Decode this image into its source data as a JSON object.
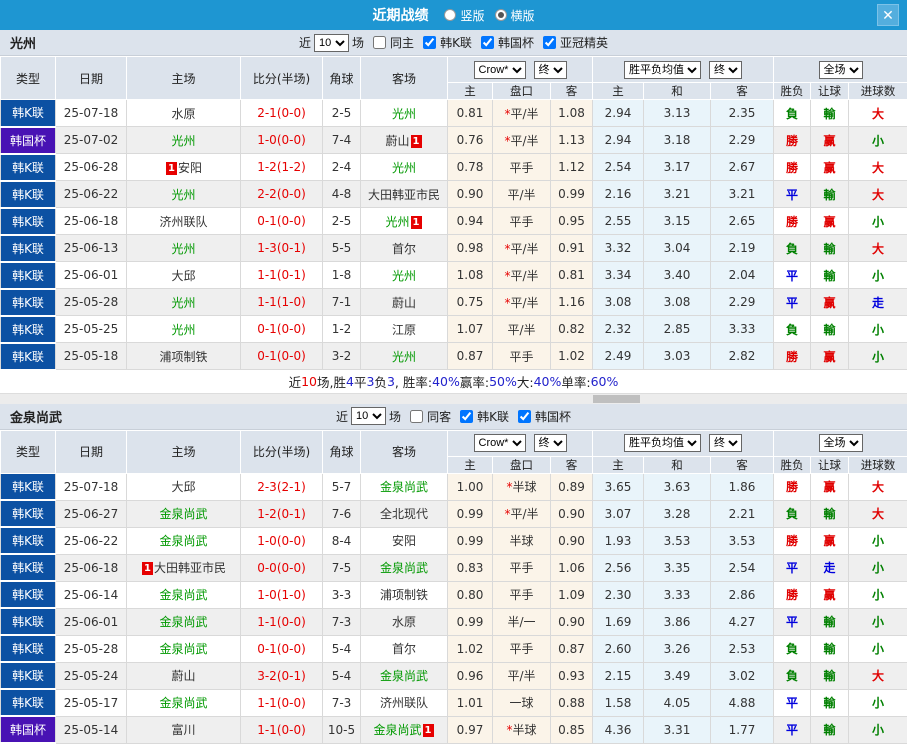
{
  "titlebar": {
    "title": "近期战绩",
    "radio_vertical": {
      "label": "竖版",
      "checked": false
    },
    "radio_horizontal": {
      "label": "横版",
      "checked": true
    },
    "close_label": "✕"
  },
  "colors": {
    "titlebar_blue": "#1e96d2",
    "league_badge_blue": "#0c51a3",
    "cup_badge_purple": "#4812b4",
    "team_green": "#009900",
    "score_red": "#e60000",
    "win_red": "#e00000",
    "loss_green": "#008000",
    "draw_blue": "#0000dd",
    "asia_odds_bg": "#fbf4e9",
    "euro_odds_bg": "#e9f4fa",
    "header_bg": "#dce3ec"
  },
  "table_header": {
    "type": "类型",
    "date": "日期",
    "home": "主场",
    "score": "比分(半场)",
    "corner": "角球",
    "away": "客场",
    "asia_home": "主",
    "handicap": "盘口",
    "asia_away": "客",
    "euro_home": "主",
    "euro_draw": "和",
    "euro_away": "客",
    "result": "胜负",
    "handicap_result": "让球",
    "goals": "进球数",
    "bookmaker_select": "Crow*",
    "final_select": "终",
    "odds_mean_select": "胜平负均值",
    "final_select2": "终",
    "scope_select": "全场"
  },
  "sections": [
    {
      "team": "光州",
      "filter": {
        "recent_label": "近",
        "count": "10",
        "matches_label": "场",
        "same": {
          "label": "同主",
          "checked": false
        },
        "leagues": [
          {
            "label": "韩K联",
            "checked": true
          },
          {
            "label": "韩国杯",
            "checked": true
          },
          {
            "label": "亚冠精英",
            "checked": true
          }
        ]
      },
      "rows": [
        {
          "type": "韩K联",
          "date": "25-07-18",
          "home": {
            "name": "水原",
            "green": false
          },
          "score": "2-1(0-0)",
          "corner": "2-5",
          "away": {
            "name": "光州",
            "green": true
          },
          "asia": [
            "0.81",
            "*平/半",
            "1.08"
          ],
          "euro": [
            "2.94",
            "3.13",
            "2.35"
          ],
          "results": [
            "負",
            "輸",
            "大"
          ]
        },
        {
          "type": "韩国杯",
          "date": "25-07-02",
          "home": {
            "name": "光州",
            "green": true
          },
          "score": "1-0(0-0)",
          "corner": "7-4",
          "away": {
            "name": "蔚山",
            "green": false,
            "badge": "1",
            "badge_pos": "after"
          },
          "asia": [
            "0.76",
            "*平/半",
            "1.13"
          ],
          "euro": [
            "2.94",
            "3.18",
            "2.29"
          ],
          "results": [
            "勝",
            "赢",
            "小"
          ]
        },
        {
          "type": "韩K联",
          "date": "25-06-28",
          "home": {
            "name": "安阳",
            "green": false,
            "badge": "1",
            "badge_pos": "before"
          },
          "score": "1-2(1-2)",
          "corner": "2-4",
          "away": {
            "name": "光州",
            "green": true
          },
          "asia": [
            "0.78",
            "平手",
            "1.12"
          ],
          "euro": [
            "2.54",
            "3.17",
            "2.67"
          ],
          "results": [
            "勝",
            "赢",
            "大"
          ]
        },
        {
          "type": "韩K联",
          "date": "25-06-22",
          "home": {
            "name": "光州",
            "green": true
          },
          "score": "2-2(0-0)",
          "corner": "4-8",
          "away": {
            "name": "大田韩亚市民",
            "green": false
          },
          "asia": [
            "0.90",
            "平/半",
            "0.99"
          ],
          "euro": [
            "2.16",
            "3.21",
            "3.21"
          ],
          "results": [
            "平",
            "輸",
            "大"
          ]
        },
        {
          "type": "韩K联",
          "date": "25-06-18",
          "home": {
            "name": "济州联队",
            "green": false
          },
          "score": "0-1(0-0)",
          "corner": "2-5",
          "away": {
            "name": "光州",
            "green": true,
            "badge": "1",
            "badge_pos": "after"
          },
          "asia": [
            "0.94",
            "平手",
            "0.95"
          ],
          "euro": [
            "2.55",
            "3.15",
            "2.65"
          ],
          "results": [
            "勝",
            "赢",
            "小"
          ]
        },
        {
          "type": "韩K联",
          "date": "25-06-13",
          "home": {
            "name": "光州",
            "green": true
          },
          "score": "1-3(0-1)",
          "corner": "5-5",
          "away": {
            "name": "首尔",
            "green": false
          },
          "asia": [
            "0.98",
            "*平/半",
            "0.91"
          ],
          "euro": [
            "3.32",
            "3.04",
            "2.19"
          ],
          "results": [
            "負",
            "輸",
            "大"
          ]
        },
        {
          "type": "韩K联",
          "date": "25-06-01",
          "home": {
            "name": "大邱",
            "green": false
          },
          "score": "1-1(0-1)",
          "corner": "1-8",
          "away": {
            "name": "光州",
            "green": true
          },
          "asia": [
            "1.08",
            "*平/半",
            "0.81"
          ],
          "euro": [
            "3.34",
            "3.40",
            "2.04"
          ],
          "results": [
            "平",
            "輸",
            "小"
          ]
        },
        {
          "type": "韩K联",
          "date": "25-05-28",
          "home": {
            "name": "光州",
            "green": true
          },
          "score": "1-1(1-0)",
          "corner": "7-1",
          "away": {
            "name": "蔚山",
            "green": false
          },
          "asia": [
            "0.75",
            "*平/半",
            "1.16"
          ],
          "euro": [
            "3.08",
            "3.08",
            "2.29"
          ],
          "results": [
            "平",
            "赢",
            "走"
          ]
        },
        {
          "type": "韩K联",
          "date": "25-05-25",
          "home": {
            "name": "光州",
            "green": true
          },
          "score": "0-1(0-0)",
          "corner": "1-2",
          "away": {
            "name": "江原",
            "green": false
          },
          "asia": [
            "1.07",
            "平/半",
            "0.82"
          ],
          "euro": [
            "2.32",
            "2.85",
            "3.33"
          ],
          "results": [
            "負",
            "輸",
            "小"
          ]
        },
        {
          "type": "韩K联",
          "date": "25-05-18",
          "home": {
            "name": "浦项制铁",
            "green": false
          },
          "score": "0-1(0-0)",
          "corner": "3-2",
          "away": {
            "name": "光州",
            "green": true
          },
          "asia": [
            "0.87",
            "平手",
            "1.02"
          ],
          "euro": [
            "2.49",
            "3.03",
            "2.82"
          ],
          "results": [
            "勝",
            "赢",
            "小"
          ]
        }
      ],
      "summary_parts": [
        {
          "t": "近",
          "c": "k"
        },
        {
          "t": "10",
          "c": "r"
        },
        {
          "t": "场,胜",
          "c": "k"
        },
        {
          "t": "4",
          "c": "b"
        },
        {
          "t": "平",
          "c": "k"
        },
        {
          "t": "3",
          "c": "b"
        },
        {
          "t": "负",
          "c": "k"
        },
        {
          "t": "3",
          "c": "b"
        },
        {
          "t": ", 胜率:",
          "c": "k"
        },
        {
          "t": "40%",
          "c": "b"
        },
        {
          "t": " 赢率:",
          "c": "k"
        },
        {
          "t": "50%",
          "c": "b"
        },
        {
          "t": " 大:",
          "c": "k"
        },
        {
          "t": "40%",
          "c": "b"
        },
        {
          "t": " 单率:",
          "c": "k"
        },
        {
          "t": "60%",
          "c": "b"
        }
      ]
    },
    {
      "team": "金泉尚武",
      "filter": {
        "recent_label": "近",
        "count": "10",
        "matches_label": "场",
        "same": {
          "label": "同客",
          "checked": false
        },
        "leagues": [
          {
            "label": "韩K联",
            "checked": true
          },
          {
            "label": "韩国杯",
            "checked": true
          }
        ]
      },
      "rows": [
        {
          "type": "韩K联",
          "date": "25-07-18",
          "home": {
            "name": "大邱",
            "green": false
          },
          "score": "2-3(2-1)",
          "corner": "5-7",
          "away": {
            "name": "金泉尚武",
            "green": true
          },
          "asia": [
            "1.00",
            "*半球",
            "0.89"
          ],
          "euro": [
            "3.65",
            "3.63",
            "1.86"
          ],
          "results": [
            "勝",
            "赢",
            "大"
          ]
        },
        {
          "type": "韩K联",
          "date": "25-06-27",
          "home": {
            "name": "金泉尚武",
            "green": true
          },
          "score": "1-2(0-1)",
          "corner": "7-6",
          "away": {
            "name": "全北现代",
            "green": false
          },
          "asia": [
            "0.99",
            "*平/半",
            "0.90"
          ],
          "euro": [
            "3.07",
            "3.28",
            "2.21"
          ],
          "results": [
            "負",
            "輸",
            "大"
          ]
        },
        {
          "type": "韩K联",
          "date": "25-06-22",
          "home": {
            "name": "金泉尚武",
            "green": true
          },
          "score": "1-0(0-0)",
          "corner": "8-4",
          "away": {
            "name": "安阳",
            "green": false
          },
          "asia": [
            "0.99",
            "半球",
            "0.90"
          ],
          "euro": [
            "1.93",
            "3.53",
            "3.53"
          ],
          "results": [
            "勝",
            "赢",
            "小"
          ]
        },
        {
          "type": "韩K联",
          "date": "25-06-18",
          "home": {
            "name": "大田韩亚市民",
            "green": false,
            "badge": "1",
            "badge_pos": "before"
          },
          "score": "0-0(0-0)",
          "corner": "7-5",
          "away": {
            "name": "金泉尚武",
            "green": true
          },
          "asia": [
            "0.83",
            "平手",
            "1.06"
          ],
          "euro": [
            "2.56",
            "3.35",
            "2.54"
          ],
          "results": [
            "平",
            "走",
            "小"
          ]
        },
        {
          "type": "韩K联",
          "date": "25-06-14",
          "home": {
            "name": "金泉尚武",
            "green": true
          },
          "score": "1-0(1-0)",
          "corner": "3-3",
          "away": {
            "name": "浦项制铁",
            "green": false
          },
          "asia": [
            "0.80",
            "平手",
            "1.09"
          ],
          "euro": [
            "2.30",
            "3.33",
            "2.86"
          ],
          "results": [
            "勝",
            "赢",
            "小"
          ]
        },
        {
          "type": "韩K联",
          "date": "25-06-01",
          "home": {
            "name": "金泉尚武",
            "green": true
          },
          "score": "1-1(0-0)",
          "corner": "7-3",
          "away": {
            "name": "水原",
            "green": false
          },
          "asia": [
            "0.99",
            "半/一",
            "0.90"
          ],
          "euro": [
            "1.69",
            "3.86",
            "4.27"
          ],
          "results": [
            "平",
            "輸",
            "小"
          ]
        },
        {
          "type": "韩K联",
          "date": "25-05-28",
          "home": {
            "name": "金泉尚武",
            "green": true
          },
          "score": "0-1(0-0)",
          "corner": "5-4",
          "away": {
            "name": "首尔",
            "green": false
          },
          "asia": [
            "1.02",
            "平手",
            "0.87"
          ],
          "euro": [
            "2.60",
            "3.26",
            "2.53"
          ],
          "results": [
            "負",
            "輸",
            "小"
          ]
        },
        {
          "type": "韩K联",
          "date": "25-05-24",
          "home": {
            "name": "蔚山",
            "green": false
          },
          "score": "3-2(0-1)",
          "corner": "5-4",
          "away": {
            "name": "金泉尚武",
            "green": true
          },
          "asia": [
            "0.96",
            "平/半",
            "0.93"
          ],
          "euro": [
            "2.15",
            "3.49",
            "3.02"
          ],
          "results": [
            "負",
            "輸",
            "大"
          ]
        },
        {
          "type": "韩K联",
          "date": "25-05-17",
          "home": {
            "name": "金泉尚武",
            "green": true
          },
          "score": "1-1(0-0)",
          "corner": "7-3",
          "away": {
            "name": "济州联队",
            "green": false
          },
          "asia": [
            "1.01",
            "一球",
            "0.88"
          ],
          "euro": [
            "1.58",
            "4.05",
            "4.88"
          ],
          "results": [
            "平",
            "輸",
            "小"
          ]
        },
        {
          "type": "韩国杯",
          "date": "25-05-14",
          "home": {
            "name": "富川",
            "green": false
          },
          "score": "1-1(0-0)",
          "corner": "10-5",
          "away": {
            "name": "金泉尚武",
            "green": true,
            "badge": "1",
            "badge_pos": "after"
          },
          "asia": [
            "0.97",
            "*半球",
            "0.85"
          ],
          "euro": [
            "4.36",
            "3.31",
            "1.77"
          ],
          "results": [
            "平",
            "輸",
            "小"
          ]
        }
      ],
      "summary_parts": []
    }
  ]
}
